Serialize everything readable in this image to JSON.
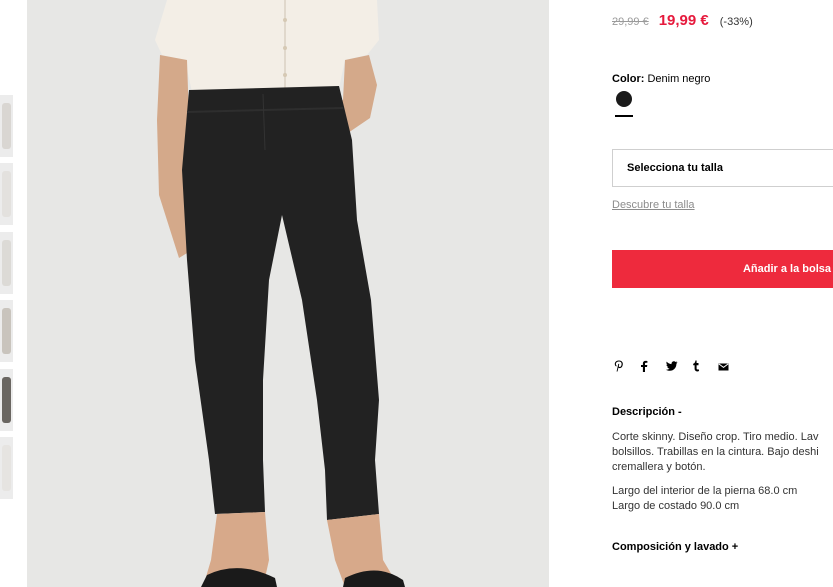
{
  "gallery": {
    "thumbnails": [
      "thumb-1",
      "thumb-2",
      "thumb-3",
      "thumb-4",
      "thumb-5",
      "thumb-6"
    ]
  },
  "product": {
    "old_price": "29,99 €",
    "price": "19,99 €",
    "discount": "(-33%)",
    "color_label": "Color:",
    "color_value": "Denim negro",
    "swatch_color": "#1a1a1a",
    "size_placeholder": "Selecciona tu talla",
    "size_guide_link": "Descubre tu talla",
    "add_to_bag": "Añadir a la bolsa",
    "accent_color": "#ee2a3d"
  },
  "share": {
    "icons": [
      "pinterest-icon",
      "facebook-icon",
      "twitter-icon",
      "tumblr-icon",
      "email-icon"
    ],
    "glyphs": [
      "℗",
      "f",
      "🐦",
      "t",
      "✉"
    ]
  },
  "description": {
    "title": "Descripción -",
    "lines": [
      "Corte skinny. Diseño crop. Tiro medio. Lav",
      "bolsillos. Trabillas en la cintura. Bajo deshi",
      "cremallera y botón."
    ],
    "measures": [
      "Largo del interior de la pierna 68.0 cm",
      "Largo de costado 90.0 cm"
    ]
  },
  "composition": {
    "title": "Composición y lavado +"
  }
}
